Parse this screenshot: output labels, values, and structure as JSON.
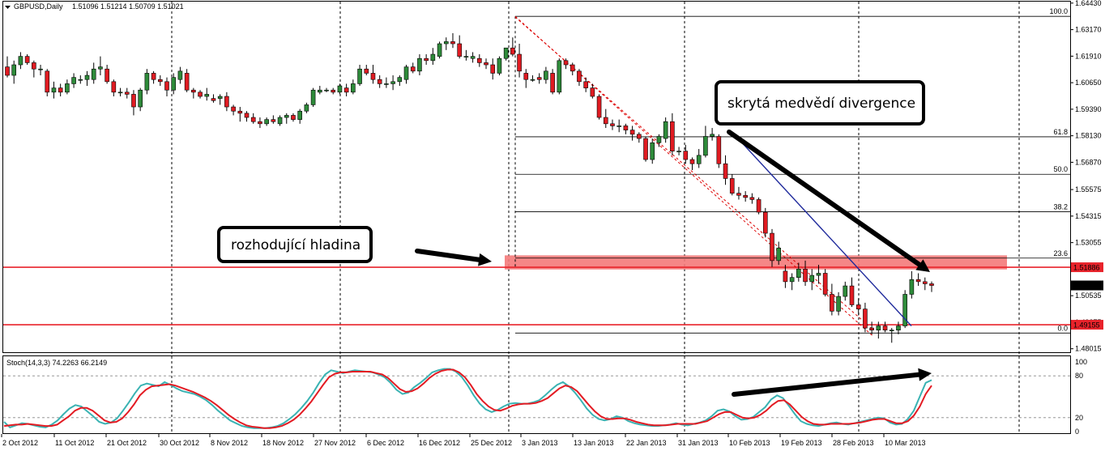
{
  "window": {
    "menu_icon": "triangle-down-icon",
    "symbol": "GBPUSD,Daily",
    "ohlc": "1.51096 1.51214 1.50709 1.51021"
  },
  "chart_data": {
    "type": "candlestick",
    "price_axis": {
      "ticks": [
        "1.64430",
        "1.63170",
        "1.61910",
        "1.60650",
        "1.59390",
        "1.58130",
        "1.56870",
        "1.55575",
        "1.54315",
        "1.53055",
        "1.51795",
        "1.50535",
        "1.49275",
        "1.48015"
      ],
      "range": [
        1.4785,
        1.645
      ]
    },
    "date_axis": {
      "labels": [
        "2 Oct 2012",
        "11 Oct 2012",
        "21 Oct 2012",
        "30 Oct 2012",
        "8 Nov 2012",
        "18 Nov 2012",
        "27 Nov 2012",
        "6 Dec 2012",
        "16 Dec 2012",
        "25 Dec 2012",
        "3 Jan 2013",
        "13 Jan 2013",
        "22 Jan 2013",
        "31 Jan 2013",
        "10 Feb 2013",
        "19 Feb 2013",
        "28 Feb 2013",
        "10 Mar 2013"
      ]
    },
    "horizontal_levels": [
      {
        "price": 1.51886,
        "label": "1.51886",
        "color": "#e8232b"
      },
      {
        "price": 1.49155,
        "label": "1.49155",
        "color": "#e8232b"
      }
    ],
    "current_price": {
      "price": 1.51021,
      "label": "1.51021"
    },
    "fibonacci": {
      "levels": [
        {
          "ratio": "100.0",
          "price": 1.638
        },
        {
          "ratio": "61.8",
          "price": 1.5808
        },
        {
          "ratio": "50.0",
          "price": 1.563
        },
        {
          "ratio": "38.2",
          "price": 1.5452
        },
        {
          "ratio": "23.6",
          "price": 1.5232
        },
        {
          "ratio": "0.0",
          "price": 1.4876
        }
      ]
    },
    "zone": {
      "from": 1.5178,
      "to": 1.5245,
      "color": "#f47a7a"
    },
    "annotations": {
      "hidden_divergence": "skrytá medvědí divergence",
      "key_level": "rozhodující hladina"
    },
    "stochastic": {
      "header": "Stoch(14,3,3) 74.2263 66.2149",
      "axis_ticks": [
        "100",
        "80",
        "20",
        "0"
      ],
      "range": [
        0,
        100
      ],
      "k_color": "#3ab3b3",
      "d_color": "#e31b23",
      "k": [
        14,
        6,
        9,
        12,
        11,
        9,
        7,
        6,
        10,
        16,
        25,
        33,
        38,
        36,
        29,
        22,
        14,
        11,
        13,
        19,
        30,
        42,
        55,
        66,
        69,
        67,
        65,
        71,
        67,
        62,
        58,
        56,
        54,
        50,
        45,
        38,
        30,
        23,
        16,
        12,
        8,
        6,
        5,
        5,
        5,
        6,
        8,
        12,
        18,
        25,
        34,
        44,
        56,
        70,
        82,
        88,
        86,
        84,
        86,
        88,
        87,
        86,
        85,
        82,
        78,
        70,
        60,
        54,
        56,
        64,
        70,
        77,
        85,
        88,
        90,
        90,
        86,
        78,
        66,
        52,
        40,
        32,
        28,
        31,
        36,
        40,
        41,
        40,
        40,
        42,
        45,
        52,
        60,
        67,
        71,
        65,
        56,
        45,
        33,
        24,
        18,
        16,
        18,
        22,
        20,
        15,
        12,
        10,
        9,
        8,
        8,
        9,
        10,
        12,
        10,
        9,
        11,
        13,
        16,
        22,
        30,
        32,
        29,
        22,
        17,
        18,
        21,
        28,
        35,
        46,
        52,
        48,
        37,
        25,
        15,
        11,
        9,
        8,
        10,
        12,
        13,
        11,
        10,
        12,
        14,
        16,
        18,
        20,
        19,
        13,
        10,
        11,
        18,
        30,
        50,
        70,
        74
      ],
      "d": [
        8,
        9,
        10,
        10,
        11,
        10,
        9,
        8,
        8,
        10,
        16,
        22,
        30,
        34,
        34,
        30,
        23,
        16,
        13,
        14,
        19,
        28,
        39,
        52,
        60,
        65,
        66,
        67,
        68,
        66,
        63,
        60,
        57,
        53,
        49,
        44,
        38,
        31,
        24,
        18,
        13,
        9,
        7,
        6,
        5,
        5,
        6,
        8,
        12,
        17,
        24,
        33,
        43,
        55,
        67,
        78,
        83,
        85,
        85,
        86,
        86,
        86,
        86,
        84,
        82,
        77,
        69,
        61,
        57,
        58,
        62,
        69,
        77,
        83,
        87,
        89,
        89,
        85,
        78,
        67,
        54,
        44,
        36,
        31,
        30,
        33,
        37,
        39,
        40,
        40,
        41,
        44,
        48,
        55,
        62,
        66,
        64,
        58,
        48,
        38,
        29,
        22,
        18,
        18,
        19,
        19,
        17,
        14,
        12,
        10,
        9,
        9,
        9,
        10,
        11,
        11,
        11,
        11,
        13,
        15,
        20,
        25,
        28,
        28,
        24,
        20,
        19,
        20,
        24,
        30,
        38,
        44,
        45,
        39,
        30,
        21,
        15,
        11,
        10,
        10,
        11,
        11,
        11,
        11,
        12,
        13,
        15,
        17,
        18,
        18,
        15,
        12,
        12,
        15,
        23,
        36,
        54,
        66
      ]
    },
    "candles": [
      [
        1.614,
        1.619,
        1.609,
        1.61
      ],
      [
        1.61,
        1.617,
        1.606,
        1.615
      ],
      [
        1.615,
        1.621,
        1.613,
        1.619
      ],
      [
        1.619,
        1.62,
        1.615,
        1.616
      ],
      [
        1.616,
        1.617,
        1.609,
        1.613
      ],
      [
        1.613,
        1.615,
        1.61,
        1.613
      ],
      [
        1.612,
        1.613,
        1.6,
        1.602
      ],
      [
        1.602,
        1.607,
        1.599,
        1.604
      ],
      [
        1.604,
        1.606,
        1.6,
        1.602
      ],
      [
        1.602,
        1.608,
        1.601,
        1.606
      ],
      [
        1.606,
        1.611,
        1.604,
        1.609
      ],
      [
        1.608,
        1.61,
        1.606,
        1.608
      ],
      [
        1.608,
        1.612,
        1.605,
        1.61
      ],
      [
        1.608,
        1.616,
        1.606,
        1.613
      ],
      [
        1.613,
        1.619,
        1.61,
        1.614
      ],
      [
        1.613,
        1.615,
        1.606,
        1.607
      ],
      [
        1.607,
        1.608,
        1.6,
        1.602
      ],
      [
        1.602,
        1.604,
        1.6,
        1.602
      ],
      [
        1.602,
        1.604,
        1.599,
        1.601
      ],
      [
        1.601,
        1.603,
        1.591,
        1.595
      ],
      [
        1.595,
        1.604,
        1.593,
        1.603
      ],
      [
        1.603,
        1.613,
        1.601,
        1.611
      ],
      [
        1.611,
        1.612,
        1.606,
        1.608
      ],
      [
        1.608,
        1.61,
        1.605,
        1.607
      ],
      [
        1.607,
        1.609,
        1.6,
        1.603
      ],
      [
        1.603,
        1.611,
        1.601,
        1.609
      ],
      [
        1.608,
        1.614,
        1.606,
        1.612
      ],
      [
        1.611,
        1.613,
        1.602,
        1.603
      ],
      [
        1.603,
        1.604,
        1.599,
        1.602
      ],
      [
        1.602,
        1.603,
        1.599,
        1.6
      ],
      [
        1.6,
        1.604,
        1.598,
        1.601
      ],
      [
        1.599,
        1.601,
        1.597,
        1.598
      ],
      [
        1.599,
        1.601,
        1.596,
        1.6
      ],
      [
        1.6,
        1.602,
        1.593,
        1.595
      ],
      [
        1.595,
        1.596,
        1.591,
        1.593
      ],
      [
        1.593,
        1.595,
        1.588,
        1.592
      ],
      [
        1.592,
        1.593,
        1.588,
        1.59
      ],
      [
        1.59,
        1.592,
        1.587,
        1.588
      ],
      [
        1.588,
        1.59,
        1.585,
        1.587
      ],
      [
        1.587,
        1.59,
        1.586,
        1.589
      ],
      [
        1.589,
        1.591,
        1.587,
        1.588
      ],
      [
        1.587,
        1.591,
        1.586,
        1.59
      ],
      [
        1.59,
        1.592,
        1.587,
        1.591
      ],
      [
        1.591,
        1.592,
        1.588,
        1.589
      ],
      [
        1.589,
        1.594,
        1.587,
        1.593
      ],
      [
        1.593,
        1.597,
        1.592,
        1.596
      ],
      [
        1.596,
        1.604,
        1.595,
        1.603
      ],
      [
        1.602,
        1.605,
        1.601,
        1.603
      ],
      [
        1.603,
        1.604,
        1.602,
        1.603
      ],
      [
        1.603,
        1.604,
        1.601,
        1.602
      ],
      [
        1.602,
        1.606,
        1.601,
        1.605
      ],
      [
        1.604,
        1.606,
        1.6,
        1.602
      ],
      [
        1.602,
        1.608,
        1.601,
        1.606
      ],
      [
        1.606,
        1.615,
        1.605,
        1.613
      ],
      [
        1.613,
        1.615,
        1.61,
        1.611
      ],
      [
        1.611,
        1.615,
        1.606,
        1.608
      ],
      [
        1.608,
        1.61,
        1.604,
        1.606
      ],
      [
        1.606,
        1.609,
        1.604,
        1.606
      ],
      [
        1.606,
        1.61,
        1.603,
        1.607
      ],
      [
        1.607,
        1.61,
        1.605,
        1.609
      ],
      [
        1.608,
        1.615,
        1.606,
        1.614
      ],
      [
        1.614,
        1.616,
        1.611,
        1.612
      ],
      [
        1.612,
        1.62,
        1.61,
        1.618
      ],
      [
        1.618,
        1.62,
        1.615,
        1.617
      ],
      [
        1.617,
        1.623,
        1.615,
        1.62
      ],
      [
        1.619,
        1.626,
        1.618,
        1.625
      ],
      [
        1.625,
        1.628,
        1.622,
        1.626
      ],
      [
        1.626,
        1.63,
        1.623,
        1.625
      ],
      [
        1.625,
        1.629,
        1.618,
        1.619
      ],
      [
        1.619,
        1.622,
        1.617,
        1.619
      ],
      [
        1.618,
        1.621,
        1.616,
        1.619
      ],
      [
        1.618,
        1.62,
        1.614,
        1.616
      ],
      [
        1.616,
        1.618,
        1.613,
        1.615
      ],
      [
        1.615,
        1.618,
        1.608,
        1.611
      ],
      [
        1.611,
        1.619,
        1.61,
        1.618
      ],
      [
        1.618,
        1.623,
        1.617,
        1.623
      ],
      [
        1.623,
        1.628,
        1.619,
        1.62
      ],
      [
        1.62,
        1.625,
        1.609,
        1.612
      ],
      [
        1.611,
        1.613,
        1.604,
        1.608
      ],
      [
        1.608,
        1.61,
        1.607,
        1.608
      ],
      [
        1.609,
        1.611,
        1.606,
        1.608
      ],
      [
        1.608,
        1.614,
        1.606,
        1.612
      ],
      [
        1.611,
        1.613,
        1.601,
        1.602
      ],
      [
        1.602,
        1.618,
        1.601,
        1.617
      ],
      [
        1.617,
        1.618,
        1.613,
        1.615
      ],
      [
        1.615,
        1.616,
        1.61,
        1.612
      ],
      [
        1.612,
        1.613,
        1.605,
        1.607
      ],
      [
        1.607,
        1.609,
        1.602,
        1.604
      ],
      [
        1.604,
        1.606,
        1.599,
        1.6
      ],
      [
        1.6,
        1.601,
        1.589,
        1.59
      ],
      [
        1.59,
        1.594,
        1.585,
        1.587
      ],
      [
        1.587,
        1.589,
        1.584,
        1.586
      ],
      [
        1.586,
        1.589,
        1.583,
        1.586
      ],
      [
        1.586,
        1.587,
        1.582,
        1.584
      ],
      [
        1.584,
        1.586,
        1.579,
        1.582
      ],
      [
        1.582,
        1.583,
        1.578,
        1.58
      ],
      [
        1.58,
        1.581,
        1.569,
        1.57
      ],
      [
        1.57,
        1.58,
        1.568,
        1.578
      ],
      [
        1.578,
        1.582,
        1.576,
        1.581
      ],
      [
        1.58,
        1.59,
        1.578,
        1.588
      ],
      [
        1.588,
        1.592,
        1.572,
        1.574
      ],
      [
        1.574,
        1.576,
        1.572,
        1.574
      ],
      [
        1.574,
        1.577,
        1.568,
        1.57
      ],
      [
        1.57,
        1.571,
        1.565,
        1.568
      ],
      [
        1.568,
        1.575,
        1.566,
        1.572
      ],
      [
        1.572,
        1.586,
        1.571,
        1.581
      ],
      [
        1.581,
        1.585,
        1.579,
        1.582
      ],
      [
        1.581,
        1.582,
        1.566,
        1.568
      ],
      [
        1.568,
        1.572,
        1.558,
        1.561
      ],
      [
        1.561,
        1.563,
        1.553,
        1.554
      ],
      [
        1.554,
        1.557,
        1.551,
        1.553
      ],
      [
        1.553,
        1.555,
        1.55,
        1.552
      ],
      [
        1.552,
        1.554,
        1.549,
        1.551
      ],
      [
        1.551,
        1.552,
        1.544,
        1.545
      ],
      [
        1.545,
        1.547,
        1.533,
        1.535
      ],
      [
        1.535,
        1.537,
        1.519,
        1.522
      ],
      [
        1.522,
        1.531,
        1.52,
        1.528
      ],
      [
        1.517,
        1.52,
        1.509,
        1.512
      ],
      [
        1.512,
        1.516,
        1.508,
        1.514
      ],
      [
        1.514,
        1.521,
        1.512,
        1.518
      ],
      [
        1.518,
        1.522,
        1.51,
        1.512
      ],
      [
        1.512,
        1.518,
        1.508,
        1.515
      ],
      [
        1.515,
        1.52,
        1.511,
        1.516
      ],
      [
        1.516,
        1.518,
        1.505,
        1.506
      ],
      [
        1.506,
        1.511,
        1.496,
        1.498
      ],
      [
        1.498,
        1.507,
        1.496,
        1.505
      ],
      [
        1.505,
        1.512,
        1.503,
        1.51
      ],
      [
        1.51,
        1.514,
        1.5,
        1.501
      ],
      [
        1.501,
        1.504,
        1.496,
        1.499
      ],
      [
        1.499,
        1.502,
        1.488,
        1.49
      ],
      [
        1.49,
        1.493,
        1.487,
        1.489
      ],
      [
        1.489,
        1.493,
        1.485,
        1.491
      ],
      [
        1.491,
        1.493,
        1.488,
        1.489
      ],
      [
        1.489,
        1.49,
        1.483,
        1.489
      ],
      [
        1.489,
        1.493,
        1.487,
        1.491
      ],
      [
        1.491,
        1.508,
        1.49,
        1.506
      ],
      [
        1.506,
        1.517,
        1.504,
        1.513
      ],
      [
        1.513,
        1.516,
        1.51,
        1.512
      ],
      [
        1.512,
        1.514,
        1.508,
        1.511
      ],
      [
        1.511,
        1.5121,
        1.5071,
        1.5102
      ]
    ]
  }
}
